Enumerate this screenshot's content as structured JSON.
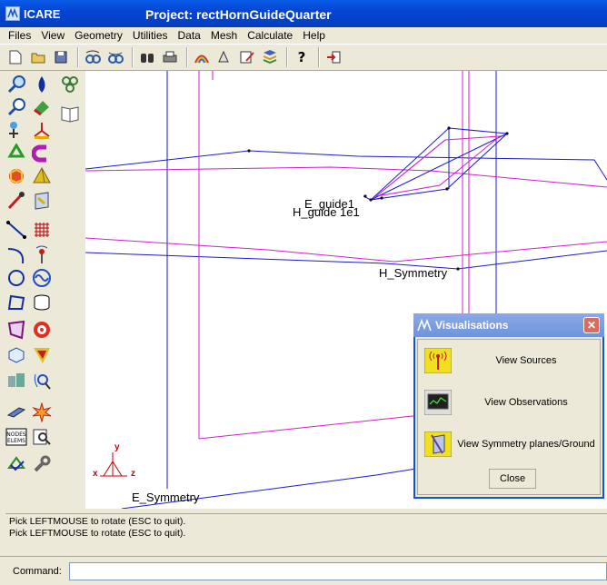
{
  "window": {
    "app_name": "ICARE",
    "project_title": "Project: rectHornGuideQuarter"
  },
  "menu": [
    "Files",
    "View",
    "Geometry",
    "Utilities",
    "Data",
    "Mesh",
    "Calculate",
    "Help"
  ],
  "toolbar": {
    "icons": [
      "new-file-icon",
      "open-folder-icon",
      "save-icon",
      "rotate-left-icon",
      "rotate-right-icon",
      "binoculars-icon",
      "print-icon",
      "rainbow-icon",
      "shapes-icon",
      "edit-note-icon",
      "layers-icon",
      "help-icon",
      "exit-icon"
    ]
  },
  "left_panel": {
    "icons": [
      "zoom-in-icon",
      "drop-icon",
      "biohazard-icon",
      "zoom-out-icon",
      "paint-icon",
      "book-icon",
      "pick-icon",
      "axes-icon",
      "recycle-icon",
      "magnet-icon",
      "cube-icon",
      "pyramid-icon",
      "pen-icon",
      "mirror-icon",
      "line-icon",
      "grid-icon",
      "curve-icon",
      "antenna-icon",
      "circle-icon",
      "wave-icon",
      "polygon-icon",
      "cylinder-icon",
      "surface-icon",
      "target-icon",
      "box-icon",
      "funnel-icon",
      "blocks-icon",
      "probe-icon",
      "plate-icon",
      "explode-icon",
      "nodes-elems-icon",
      "inspect-icon",
      "mesh-check-icon",
      "wrench-icon"
    ]
  },
  "viewport": {
    "labels": {
      "e_guide": "E_guide1",
      "h_guide": "H_guide 1e1",
      "h_symmetry": "H_Symmetry",
      "e_symmetry": "E_Symmetry"
    },
    "axes": {
      "x": "x",
      "y": "y",
      "z": "z"
    },
    "colors": {
      "blue": "#1a1acc",
      "magenta": "#cc22cc",
      "axes": "#cc0000"
    }
  },
  "dialog": {
    "title": "Visualisations",
    "close_x": "✕",
    "buttons": [
      {
        "label": "View Sources",
        "icon": "source-antenna-icon"
      },
      {
        "label": "View Observations",
        "icon": "oscilloscope-icon"
      },
      {
        "label": "View Symmetry planes/Ground",
        "icon": "symmetry-plane-icon"
      }
    ],
    "close_label": "Close"
  },
  "status": {
    "lines": [
      "Pick LEFTMOUSE to rotate (ESC to quit).",
      "Pick LEFTMOUSE to rotate (ESC to quit)."
    ]
  },
  "command": {
    "label": "Command:",
    "value": ""
  }
}
